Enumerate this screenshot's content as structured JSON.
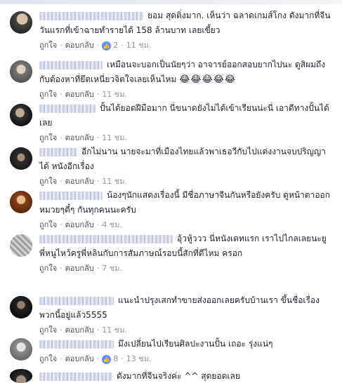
{
  "ui": {
    "like": "ถูกใจ",
    "reply": "ตอบกลับ",
    "sep": "·"
  },
  "comments": [
    {
      "text": "ยอม สุดติ่งมาก. เห็นว่า ฉลาดเกมส์โกง ดังมากที่จีน วันแรกที่เข้าฉายทำรายได้ 158 ล้านบาท เลยเขี้ยว",
      "reactions": "2",
      "time": "11 ชม."
    },
    {
      "text": "เหมือนจะบอกเป็นนัยๆว่า อาจารย์ออกสอบยากไปนะ ดูสิผมถึงกับต้องหาที่ยึดเหนี่ยวจิตใจเลยเห็นไหม",
      "emoji": "😂😂😂😂😂",
      "time": "11 ชม."
    },
    {
      "text": "ปั้นได้ยอดฝีมือมาก นี่ขนาดยังไม่ได้เข้าเรียนน่ะนี่ เอาดีทางปั้นได้เลย",
      "time": "11 ชม."
    },
    {
      "text": "อีกไม่นาน นายจะมาที่เมืองไทยแล้วพาเธอวีกับไปแต่งงานจบปริญญาได้ หนังอีกเรื่อง",
      "time": "11 ชม."
    },
    {
      "text": "น้องๆนักแสดงเรื่องนี้ มีชื่อภาษาจีนกันหรือยังครับ ดูหน้าตาออกหมวยๆตี๋ๆ กันทุกคนนะครับ",
      "time": "4 ชม."
    },
    {
      "text": "อุ้วหู้ววว นี่หนังเดทแรก เราไปไกลเลยนะยู พี่หนูไหว้ครูพี่หลินกับการสัมภาษณ์รอบนี้สักที่ดีไหม ครอก",
      "time": "7 ชม."
    },
    {
      "text": "แนะนำปรุงเสกทำขายส่งออกเลยครับบ้านเรา ขึ้นชื่อเรื่องพวกนี้อยู่แล้ว5555",
      "time": "11 ชม."
    },
    {
      "text": "มึงเปลี่ยนไปเรียนศิลปะงานปั้น เถอะ รุ่งแน่ๆ",
      "reactions": "8",
      "time": "13 ชม."
    },
    {
      "text": "ดังมากที่จีนจริงค่ะ ^^ สุดยอดเลย"
    }
  ]
}
